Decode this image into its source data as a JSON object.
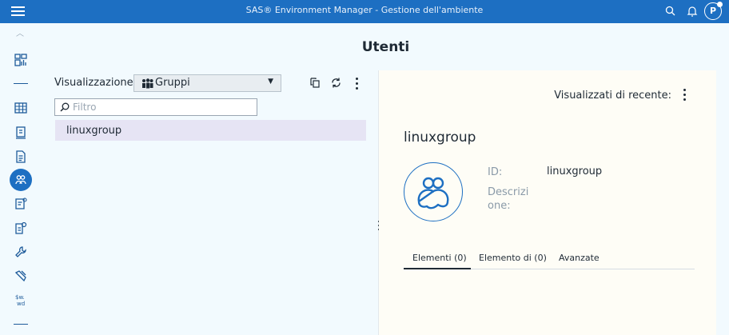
{
  "topbar": {
    "title": "SAS® Environment Manager - Gestione dell'ambiente",
    "avatar_initial": "P"
  },
  "page": {
    "title": "Utenti"
  },
  "left_panel": {
    "view_label": "Visualizzazione:",
    "view_selected": "Gruppi",
    "filter_placeholder": "Filtro",
    "items": [
      {
        "label": "linuxgroup"
      }
    ]
  },
  "right_panel": {
    "recent_label": "Visualizzati di recente:",
    "group_name": "linuxgroup",
    "id_label": "ID:",
    "id_value": "linuxgroup",
    "description_label": "Descrizi\none:",
    "tabs": [
      {
        "label": "Elementi (0)",
        "active": true
      },
      {
        "label": "Elemento di (0)",
        "active": false
      },
      {
        "label": "Avanzate",
        "active": false
      }
    ]
  },
  "icons": {
    "nav": [
      "dashboard-icon",
      "table-icon",
      "report-icon",
      "document-icon",
      "users-icon",
      "config-icon",
      "security-icon",
      "wrench-icon",
      "tools-icon",
      "formats-icon"
    ],
    "toolbar": [
      "copy-icon",
      "refresh-icon",
      "more-icon"
    ]
  },
  "colors": {
    "accent": "#1d6fc2",
    "selected_row": "#e6e4f4"
  }
}
